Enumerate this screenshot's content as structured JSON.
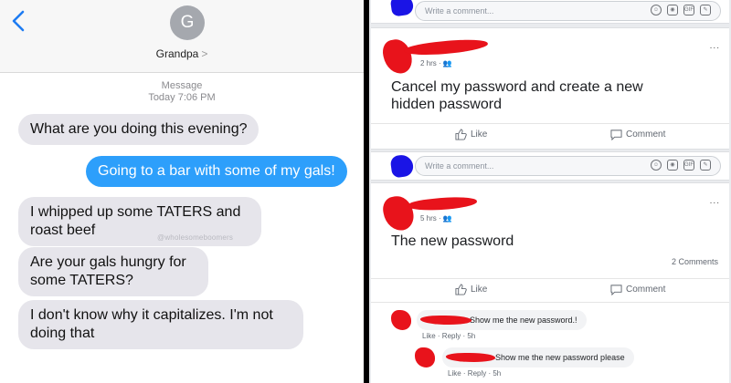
{
  "imessage": {
    "contact_initial": "G",
    "contact_name": "Grandpa",
    "contact_arrow": ">",
    "label_message": "Message",
    "timestamp": "Today 7:06 PM",
    "watermark": "@wholesomeboomers",
    "messages": [
      {
        "from": "them",
        "text": "What are you doing this evening?"
      },
      {
        "from": "me",
        "text": "Going to a bar with some of my gals!"
      },
      {
        "from": "them",
        "lines": [
          "I whipped up some TATERS and",
          "roast beef"
        ]
      },
      {
        "from": "them",
        "lines": [
          "Are your gals hungry for",
          "some TATERS?"
        ]
      },
      {
        "from": "them",
        "lines": [
          "I don't know why it capitalizes. I'm not",
          "doing that"
        ]
      }
    ],
    "colors": {
      "incoming": "#e6e5eb",
      "outgoing": "#2d9ffb",
      "link": "#1e7cf2"
    }
  },
  "facebook": {
    "comment_placeholder": "Write a comment...",
    "comment_icons": [
      "smiley-icon",
      "camera-icon",
      "gif-icon",
      "sticker-icon"
    ],
    "gif_label": "GIF",
    "more_label": "...",
    "like_label": "Like",
    "comment_label": "Comment",
    "posts": [
      {
        "time": "2 hrs",
        "privacy_icon": "friends-icon",
        "lines": [
          "Cancel my password and create a new",
          "hidden password"
        ]
      },
      {
        "time": "5 hrs",
        "privacy_icon": "friends-icon",
        "lines": [
          "The new password"
        ],
        "comments_count": "2 Comments"
      }
    ],
    "comments": [
      {
        "text": "Show me the new password.!",
        "actions": "Like · Reply · 5h"
      },
      {
        "text": "Show me the new password please",
        "actions": "Like · Reply · 5h"
      }
    ],
    "colors": {
      "avatar": "#1a14e6",
      "redaction": "#e8131b",
      "background": "#e9ebee"
    }
  }
}
